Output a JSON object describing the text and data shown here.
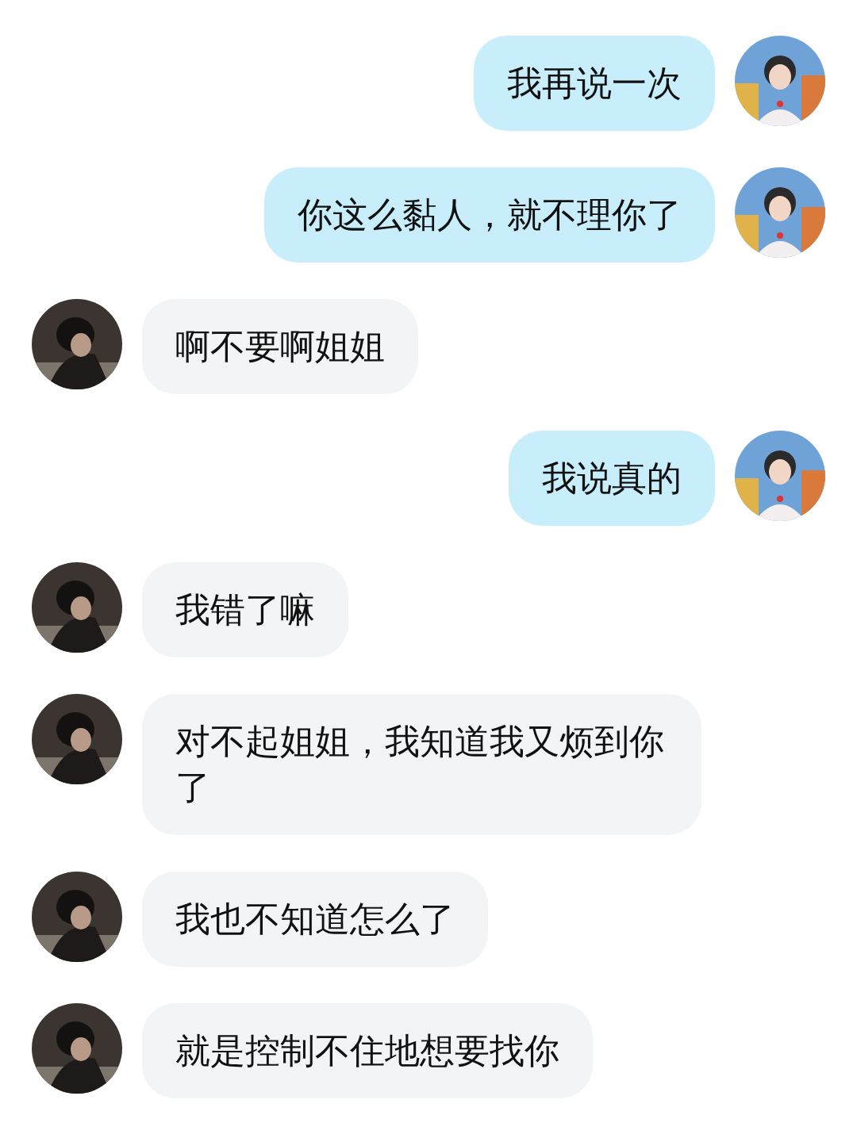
{
  "messages": [
    {
      "kind": "sent",
      "text": "我再说一次"
    },
    {
      "kind": "sent",
      "text": "你这么黏人，就不理你了"
    },
    {
      "kind": "received",
      "text": "啊不要啊姐姐"
    },
    {
      "kind": "sent",
      "text": "我说真的"
    },
    {
      "kind": "received",
      "text": "我错了嘛"
    },
    {
      "kind": "received",
      "text": "对不起姐姐，我知道我又烦到你了"
    },
    {
      "kind": "received",
      "text": "我也不知道怎么了"
    },
    {
      "kind": "received",
      "text": "就是控制不住地想要找你"
    }
  ]
}
